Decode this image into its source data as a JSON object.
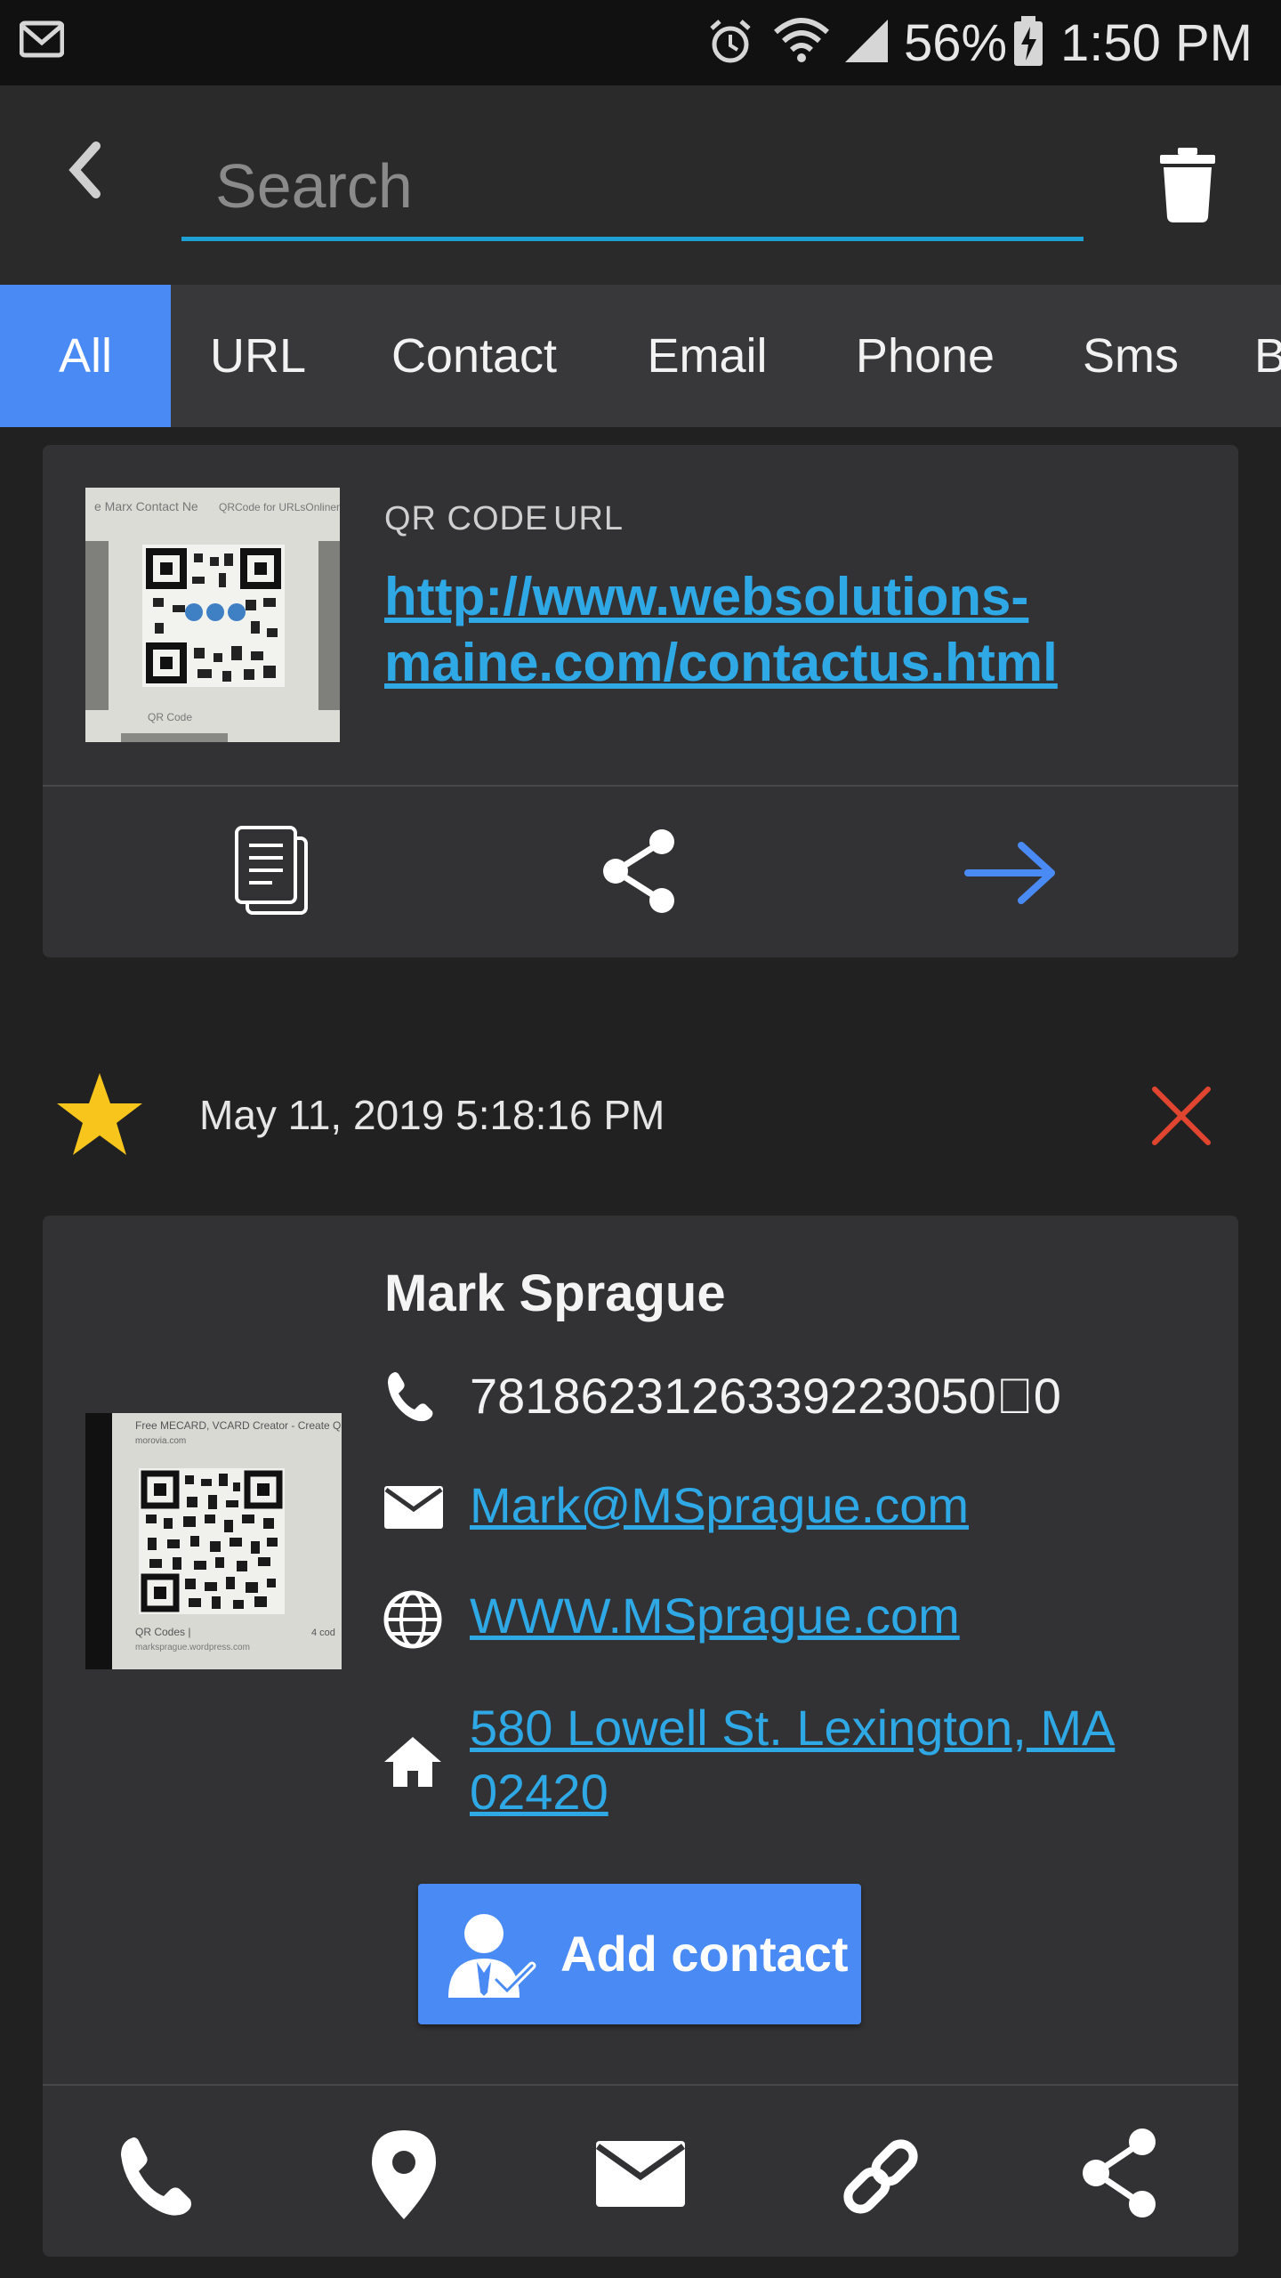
{
  "status_bar": {
    "battery": "56%",
    "time": "1:50 PM",
    "icons": [
      "gmail-icon",
      "alarm-icon",
      "wifi-icon",
      "signal-icon",
      "battery-charging-icon"
    ]
  },
  "search": {
    "placeholder": "Search",
    "value": ""
  },
  "toolbar": {
    "back_icon": "back-arrow-icon",
    "delete_icon": "trash-icon"
  },
  "tabs": [
    {
      "label": "All",
      "active": true
    },
    {
      "label": "URL"
    },
    {
      "label": "Contact"
    },
    {
      "label": "Email"
    },
    {
      "label": "Phone"
    },
    {
      "label": "Sms"
    },
    {
      "label": "B"
    }
  ],
  "url_card": {
    "type": "QR CODE",
    "subtype": "URL",
    "link": "http://www.websolutions-maine.com/contactus.html",
    "actions": [
      "copy-icon",
      "share-icon",
      "open-arrow-icon"
    ],
    "accent": "#4a8af4"
  },
  "history_item": {
    "date": "May 11, 2019 5:18:16 PM",
    "favorite": true,
    "star_color": "#f8c51c",
    "delete_color": "#e0452f"
  },
  "contact_card": {
    "name": "Mark Sprague",
    "phone": "7818623126339223050\u00000",
    "email": "Mark@MSprague.com",
    "website": "WWW.MSprague.com",
    "address": "580 Lowell St. Lexington, MA 02420",
    "add_button": "Add contact",
    "actions": [
      "phone-icon",
      "location-pin-icon",
      "email-icon",
      "link-icon",
      "share-icon"
    ],
    "thumb_text": [
      "Free MECARD, VCARD Creator - Create QR",
      "morovia.com",
      "QR Codes |",
      "marksprague.wordpress.com",
      "4 cod"
    ]
  },
  "url_thumb_text": [
    "e Marx Contact Ne",
    "QRCode for URLsOnlinem",
    "QR Code"
  ]
}
